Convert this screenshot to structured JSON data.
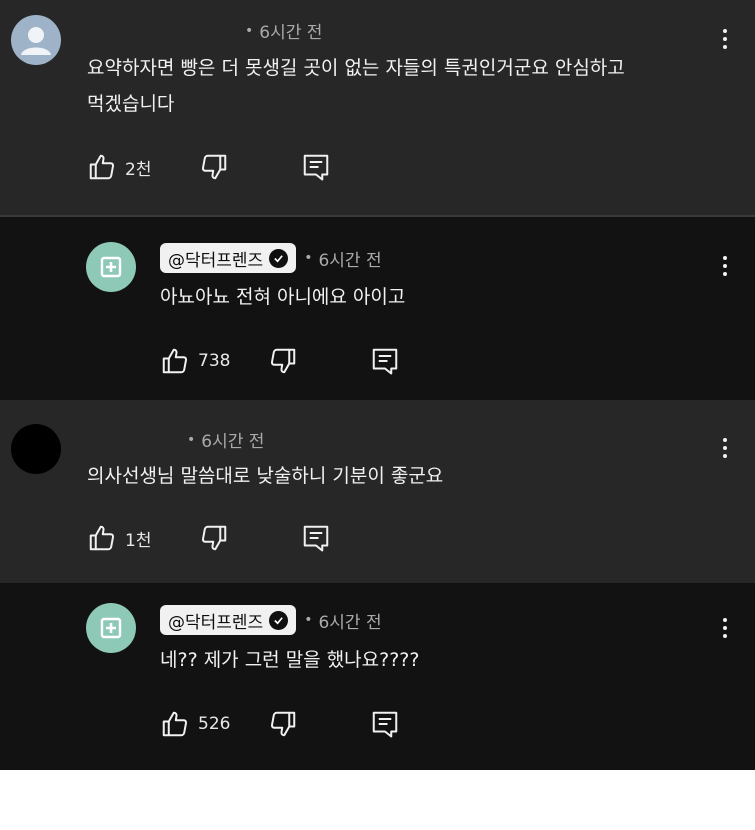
{
  "colors": {
    "top_bg": "#272727",
    "reply_bg": "#121212",
    "text": "#f1f1f1",
    "meta": "#aaaaaa",
    "channel_avatar": "#8ec9b8"
  },
  "comments": [
    {
      "kind": "top",
      "avatar": "default-user-avatar",
      "time": "6시간 전",
      "text_lines": [
        "요약하자면 빵은 더 못생길 곳이 없는 자들의 특권인거군요 안심하고",
        "먹겠습니다"
      ],
      "likes": "2천"
    },
    {
      "kind": "reply",
      "avatar": "channel-avatar-cross",
      "author": "@닥터프렌즈",
      "time": "6시간 전",
      "text_lines": [
        "아뇨아뇨 전혀 아니에요 아이고"
      ],
      "likes": "738"
    },
    {
      "kind": "top",
      "avatar": "black-avatar",
      "time": "6시간 전",
      "text_lines": [
        "의사선생님 말씀대로 낮술하니 기분이 좋군요"
      ],
      "likes": "1천"
    },
    {
      "kind": "reply",
      "avatar": "channel-avatar-cross",
      "author": "@닥터프렌즈",
      "time": "6시간 전",
      "text_lines": [
        "네?? 제가 그런 말을 했나요????"
      ],
      "likes": "526"
    }
  ]
}
